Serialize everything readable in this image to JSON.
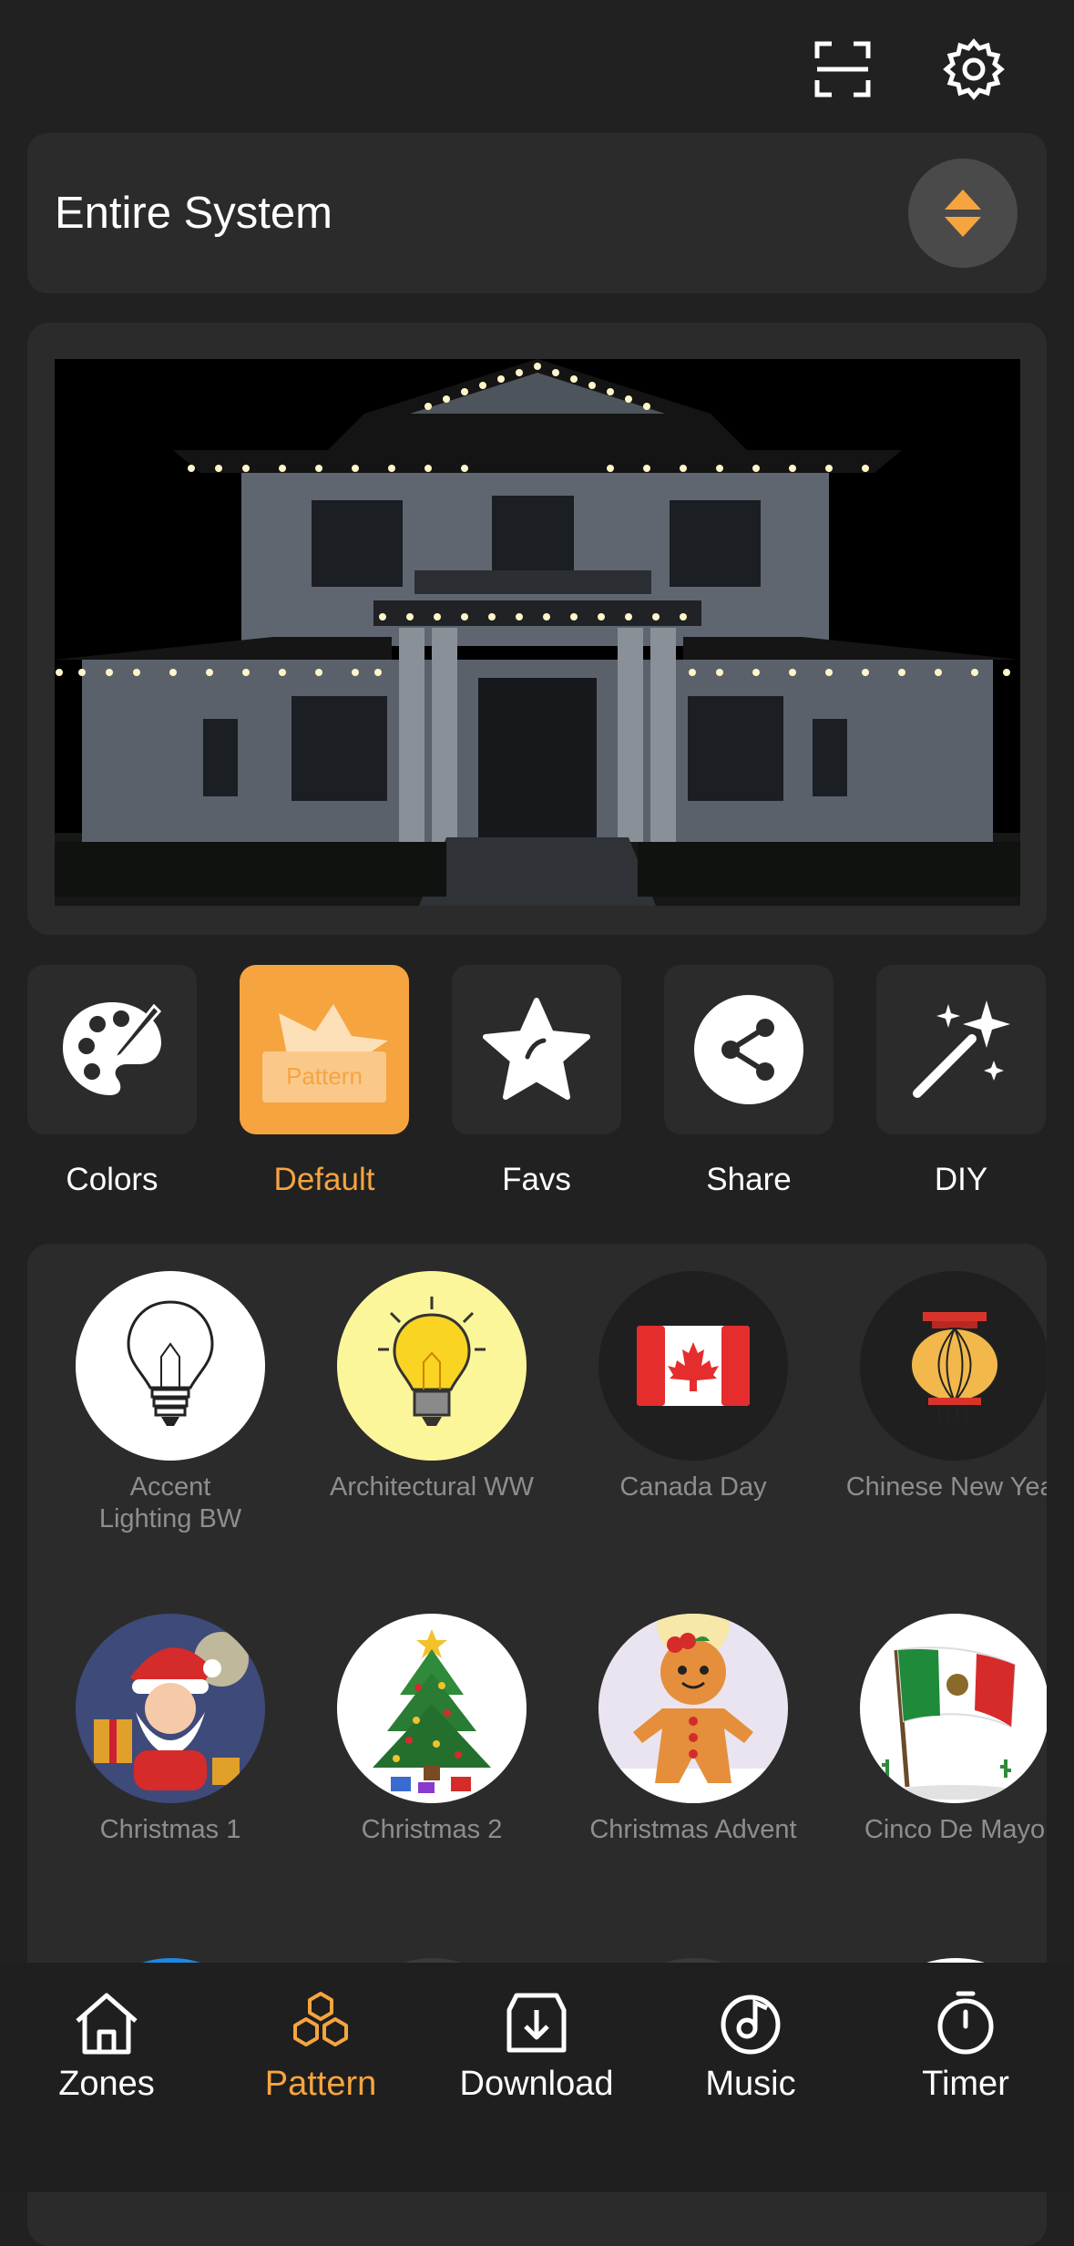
{
  "zone": {
    "title": "Entire System"
  },
  "tools": [
    {
      "label": "Colors",
      "icon": "palette-icon"
    },
    {
      "label": "Default",
      "icon": "pattern-icon",
      "badge": "Pattern",
      "active": true
    },
    {
      "label": "Favs",
      "icon": "star-icon"
    },
    {
      "label": "Share",
      "icon": "share-icon"
    },
    {
      "label": "DIY",
      "icon": "magic-wand-icon"
    }
  ],
  "patterns": [
    {
      "label": "Accent\nLighting BW",
      "icon": "lightbulb-sketch-icon"
    },
    {
      "label": "Architectural WW",
      "icon": "lightbulb-yellow-icon"
    },
    {
      "label": "Canada Day",
      "icon": "canada-flag-icon"
    },
    {
      "label": "Chinese New Year",
      "icon": "lantern-icon"
    },
    {
      "label": "Christmas 1",
      "icon": "santa-icon"
    },
    {
      "label": "Christmas 2",
      "icon": "christmas-tree-icon"
    },
    {
      "label": "Christmas Advent",
      "icon": "gingerbread-icon"
    },
    {
      "label": "Cinco De Mayo",
      "icon": "mexico-flag-icon"
    }
  ],
  "nav": [
    {
      "label": "Zones",
      "icon": "home-icon"
    },
    {
      "label": "Pattern",
      "icon": "hexagons-icon",
      "active": true
    },
    {
      "label": "Download",
      "icon": "download-icon"
    },
    {
      "label": "Music",
      "icon": "music-icon"
    },
    {
      "label": "Timer",
      "icon": "stopwatch-icon"
    }
  ],
  "colors": {
    "accent": "#F6A440",
    "background": "#212121",
    "card": "#2B2B2B",
    "muted_text": "#8E8E8E"
  }
}
